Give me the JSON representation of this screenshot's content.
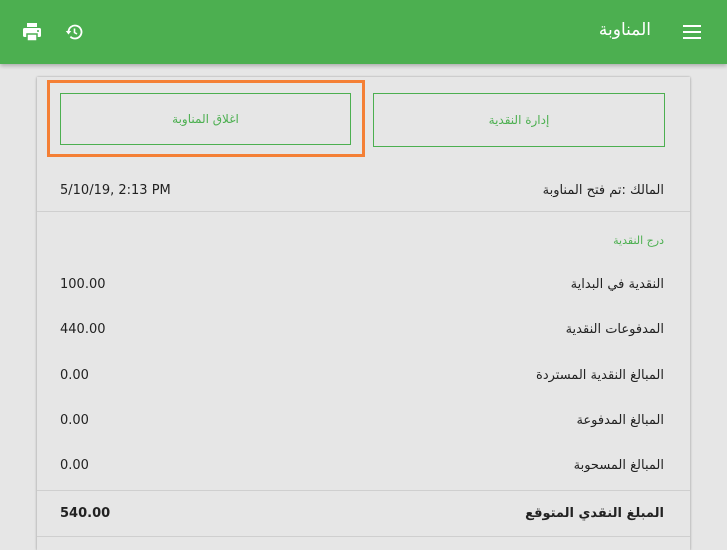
{
  "header": {
    "title": "المناوبة",
    "icons": [
      "print-icon",
      "history-icon",
      "menu-icon"
    ],
    "bar_color": "#4caf50"
  },
  "actions": {
    "close_shift_label": "اغلاق المناوبة",
    "manage_cash_label": "إدارة النقدية",
    "highlight_color": "#f47f35"
  },
  "shift_info": {
    "opened_by_label": "المالك :تم فتح المناوبة",
    "opened_at": "5/10/19, 2:13 PM"
  },
  "cash_drawer": {
    "section_title": "درج النقدية",
    "rows": [
      {
        "label": "النقدية في البداية",
        "value": "100.00"
      },
      {
        "label": "المدفوعات النقدية",
        "value": "440.00"
      },
      {
        "label": "المبالغ النقدية المستردة",
        "value": "0.00"
      },
      {
        "label": "المبالغ المدفوعة",
        "value": "0.00"
      },
      {
        "label": "المبالغ المسحوبة",
        "value": "0.00"
      }
    ],
    "expected": {
      "label": "المبلغ النقدي المتوقع",
      "value": "540.00"
    }
  }
}
